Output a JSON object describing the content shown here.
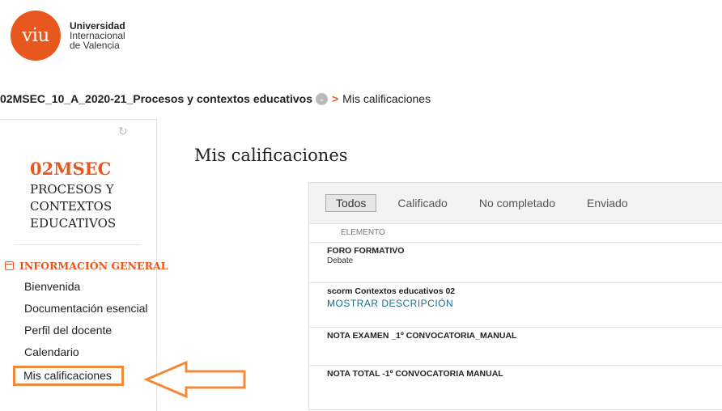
{
  "logo": {
    "mark": "viu",
    "line1": "Universidad",
    "line2": "Internacional",
    "line3": "de Valencia"
  },
  "breadcrumb": {
    "course": "02MSEC_10_A_2020-21_Procesos y contextos educativos",
    "chevron": "⌄",
    "separator": ">",
    "current": "Mis calificaciones"
  },
  "sidebar": {
    "refresh_icon": "↻",
    "course_code": "02MSEC",
    "course_name": "PROCESOS Y CONTEXTOS EDUCATIVOS",
    "section": "INFORMACIÓN GENERAL",
    "items": [
      {
        "label": "Bienvenida"
      },
      {
        "label": "Documentación esencial"
      },
      {
        "label": "Perfil del docente"
      },
      {
        "label": "Calendario"
      },
      {
        "label": "Mis calificaciones"
      }
    ]
  },
  "main": {
    "title": "Mis calificaciones",
    "tabs": [
      {
        "label": "Todos",
        "selected": true
      },
      {
        "label": "Calificado"
      },
      {
        "label": "No completado"
      },
      {
        "label": "Enviado"
      }
    ],
    "column_header": "ELEMENTO",
    "rows": [
      {
        "title": "FORO FORMATIVO",
        "sub": "Debate"
      },
      {
        "title": "scorm Contextos educativos 02",
        "link": "MOSTRAR DESCRIPCIÓN"
      },
      {
        "title": "NOTA EXAMEN _1º CONVOCATORIA_MANUAL"
      },
      {
        "title": "NOTA TOTAL -1º CONVOCATORIA MANUAL"
      }
    ]
  },
  "colors": {
    "brand": "#e8571e",
    "annotation": "#f08a3a",
    "link": "#1d6e8a"
  }
}
